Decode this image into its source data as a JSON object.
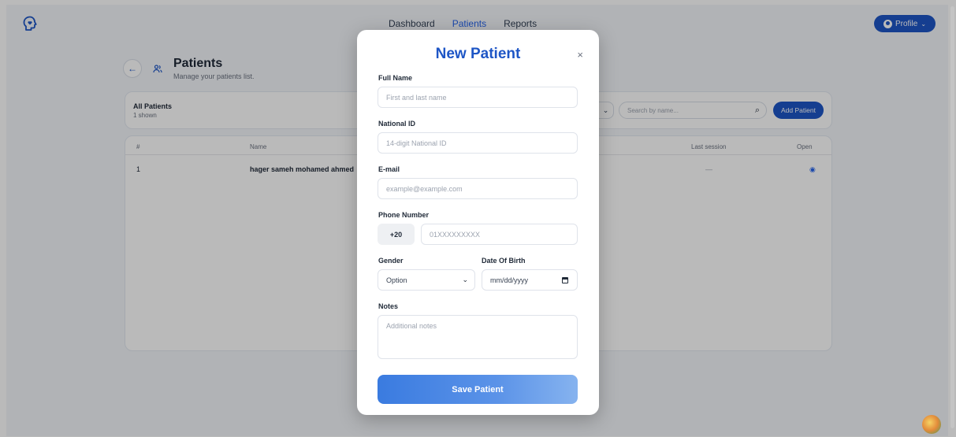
{
  "nav": {
    "items": [
      "Dashboard",
      "Patients",
      "Reports"
    ],
    "active_index": 1
  },
  "profile": {
    "label": "Profile"
  },
  "page": {
    "title": "Patients",
    "subtitle": "Manage your patients list."
  },
  "patients_card": {
    "title": "All Patients",
    "count_text": "1 shown",
    "search_placeholder": "Search by name...",
    "add_button": "Add Patient"
  },
  "table": {
    "headers": [
      "#",
      "Name",
      "Last session",
      "Open"
    ],
    "rows": [
      {
        "index": "1",
        "name": "hager sameh mohamed ahmed",
        "last_session": "—"
      }
    ]
  },
  "modal": {
    "title": "New Patient",
    "close_symbol": "×",
    "full_name": {
      "label": "Full Name",
      "placeholder": "First and last name"
    },
    "national_id": {
      "label": "National ID",
      "placeholder": "14-digit National ID"
    },
    "email": {
      "label": "E-mail",
      "placeholder": "example@example.com"
    },
    "phone": {
      "label": "Phone Number",
      "prefix": "+20",
      "placeholder": "01XXXXXXXXX"
    },
    "gender": {
      "label": "Gender",
      "value": "Option"
    },
    "dob": {
      "label": "Date Of Birth",
      "value": "mm/dd/yyyy"
    },
    "notes": {
      "label": "Notes",
      "placeholder": "Additional notes"
    },
    "save_label": "Save Patient"
  },
  "colors": {
    "primary": "#1e56c6",
    "accent": "#2563eb"
  }
}
